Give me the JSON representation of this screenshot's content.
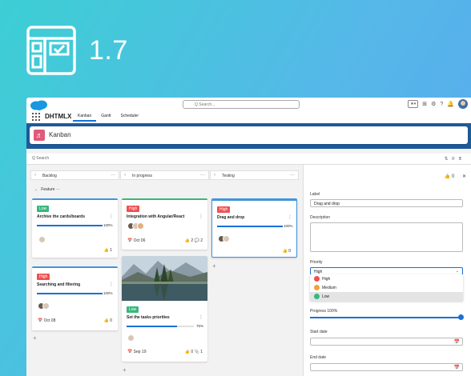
{
  "hero": {
    "version": "1.7"
  },
  "topbar": {
    "search_placeholder": "Q Search...",
    "app_name": "DHTMLX",
    "tabs": [
      {
        "label": "Kanban",
        "active": true
      },
      {
        "label": "Gantt",
        "active": false
      },
      {
        "label": "Scheduler",
        "active": false
      }
    ]
  },
  "page": {
    "title": "Kanban"
  },
  "toolbar": {
    "search_label": "Q Search"
  },
  "columns": [
    {
      "label": "Backlog"
    },
    {
      "label": "In progress"
    },
    {
      "label": "Testing"
    }
  ],
  "swimlane": {
    "label": "Feature",
    "more": "···"
  },
  "cards": [
    {
      "tag": "Low",
      "tag_color": "#37b87c",
      "bar_color": "#3e95dd",
      "title": "Archive the cards/boards",
      "progress_label": "100%",
      "progress": 1.0,
      "likes": "1"
    },
    {
      "tag": "High",
      "tag_color": "#f05050",
      "bar_color": "#3e95dd",
      "title": "Searching and filtering",
      "progress_label": "100%",
      "progress": 1.0,
      "date": "Oct 08",
      "likes": "0"
    },
    {
      "tag": "High",
      "tag_color": "#f05050",
      "bar_color": "#37b87c",
      "title": "Integration with Angular/React",
      "date": "Oct 06",
      "likes": "2",
      "comments": "2"
    },
    {
      "tag": "Low",
      "tag_color": "#37b87c",
      "title": "Set the tasks priorities",
      "progress_label": "75%",
      "progress": 0.75,
      "date": "Sep 19",
      "likes": "0",
      "attachments": "1"
    },
    {
      "tag": "High",
      "tag_color": "#f05050",
      "bar_color": "#3e95dd",
      "title": "Drag and drop",
      "progress_label": "100%",
      "progress": 1.0,
      "likes": "0"
    }
  ],
  "editor": {
    "likes": "0",
    "label_title": "Label",
    "label_value": "Drag and drop",
    "description_title": "Description",
    "priority_title": "Priority",
    "priority_value": "High",
    "priority_options": [
      {
        "label": "High",
        "color": "#f05050"
      },
      {
        "label": "Medium",
        "color": "#f0a33c"
      },
      {
        "label": "Low",
        "color": "#37b87c"
      }
    ],
    "progress_title": "Progress 100%",
    "progress": 1.0,
    "start_date_title": "Start date",
    "end_date_title": "End date"
  }
}
